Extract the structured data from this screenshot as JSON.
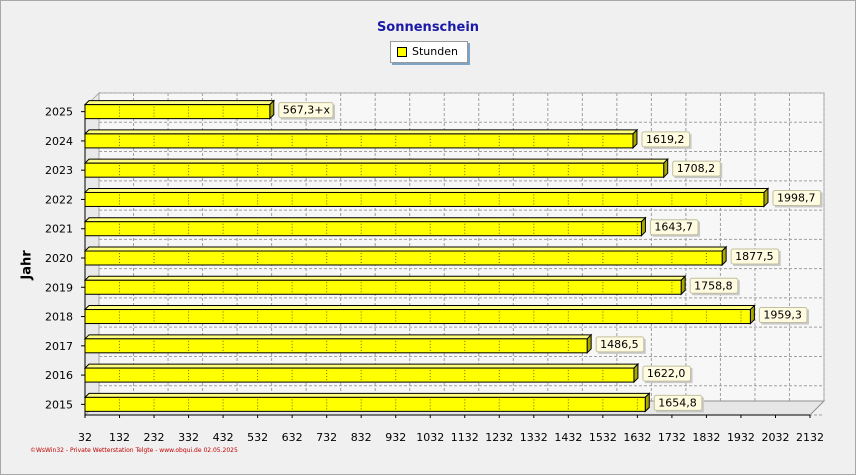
{
  "chart_data": {
    "type": "bar",
    "orientation": "horizontal",
    "title": "Sonnenschein",
    "ylabel": "Jahr",
    "xlabel": "",
    "categories": [
      "2025",
      "2024",
      "2023",
      "2022",
      "2021",
      "2020",
      "2019",
      "2018",
      "2017",
      "2016",
      "2015"
    ],
    "series": [
      {
        "name": "Stunden",
        "values": [
          567.3,
          1619.2,
          1708.2,
          1998.7,
          1643.7,
          1877.5,
          1758.8,
          1959.3,
          1486.5,
          1622.0,
          1654.8
        ],
        "labels": [
          "567,3+x",
          "1619,2",
          "1708,2",
          "1998,7",
          "1643,7",
          "1877,5",
          "1758,8",
          "1959,3",
          "1486,5",
          "1622,0",
          "1654,8"
        ]
      }
    ],
    "xlim": [
      32,
      2132
    ],
    "xticks": [
      "32",
      "132",
      "232",
      "332",
      "432",
      "532",
      "632",
      "732",
      "832",
      "932",
      "1032",
      "1132",
      "1232",
      "1332",
      "1432",
      "1532",
      "1632",
      "1732",
      "1832",
      "1932",
      "2032",
      "2132"
    ],
    "grid": true,
    "legend_position": "top-center",
    "colors": {
      "bar": "#ffff00",
      "bar_side": "#a8a800",
      "title": "#1a1aa6",
      "footer": "#c00000",
      "grid": "#a0a0a0"
    }
  },
  "footer_text": "©WsWin32 - Private Wetterstation Telgte - www.obqui.de 02.05.2025"
}
